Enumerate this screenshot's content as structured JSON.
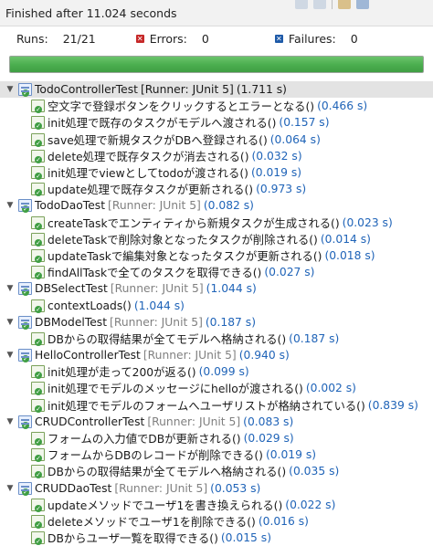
{
  "status": {
    "text": "Finished after 11.024 seconds"
  },
  "counters": {
    "runs_label": "Runs:",
    "runs_value": "21/21",
    "errors_label": "Errors:",
    "errors_value": "0",
    "failures_label": "Failures:",
    "failures_value": "0"
  },
  "progress": {
    "fraction": 1.0,
    "color": "#4caf50"
  },
  "suites": [
    {
      "name": "TodoControllerTest",
      "runner": "[Runner: JUnit 5]",
      "time": "(1.711 s)",
      "tests": [
        {
          "name": "空文字で登録ボタンをクリックするとエラーとなる()",
          "time": "(0.466 s)"
        },
        {
          "name": "init処理で既存のタスクがモデルへ渡される()",
          "time": "(0.157 s)"
        },
        {
          "name": "save処理で新規タスクがDBへ登録される()",
          "time": "(0.064 s)"
        },
        {
          "name": "delete処理で既存タスクが消去される()",
          "time": "(0.032 s)"
        },
        {
          "name": "init処理でviewとしてtodoが渡される()",
          "time": "(0.019 s)"
        },
        {
          "name": "update処理で既存タスクが更新される()",
          "time": "(0.973 s)"
        }
      ]
    },
    {
      "name": "TodoDaoTest",
      "runner": "[Runner: JUnit 5]",
      "time": "(0.082 s)",
      "tests": [
        {
          "name": "createTaskでエンティティから新規タスクが生成される()",
          "time": "(0.023 s)"
        },
        {
          "name": "deleteTaskで削除対象となったタスクが削除される()",
          "time": "(0.014 s)"
        },
        {
          "name": "updateTaskで編集対象となったタスクが更新される()",
          "time": "(0.018 s)"
        },
        {
          "name": "findAllTaskで全てのタスクを取得できる()",
          "time": "(0.027 s)"
        }
      ]
    },
    {
      "name": "DBSelectTest",
      "runner": "[Runner: JUnit 5]",
      "time": "(1.044 s)",
      "tests": [
        {
          "name": "contextLoads()",
          "time": "(1.044 s)"
        }
      ]
    },
    {
      "name": "DBModelTest",
      "runner": "[Runner: JUnit 5]",
      "time": "(0.187 s)",
      "tests": [
        {
          "name": "DBからの取得結果が全てモデルへ格納される()",
          "time": "(0.187 s)"
        }
      ]
    },
    {
      "name": "HelloControllerTest",
      "runner": "[Runner: JUnit 5]",
      "time": "(0.940 s)",
      "tests": [
        {
          "name": "init処理が走って200が返る()",
          "time": "(0.099 s)"
        },
        {
          "name": "init処理でモデルのメッセージにhelloが渡される()",
          "time": "(0.002 s)"
        },
        {
          "name": "init処理でモデルのフォームへユーザリストが格納されている()",
          "time": "(0.839 s)"
        }
      ]
    },
    {
      "name": "CRUDControllerTest",
      "runner": "[Runner: JUnit 5]",
      "time": "(0.083 s)",
      "tests": [
        {
          "name": "フォームの入力値でDBが更新される()",
          "time": "(0.029 s)"
        },
        {
          "name": "フォームからDBのレコードが削除できる()",
          "time": "(0.019 s)"
        },
        {
          "name": "DBからの取得結果が全てモデルへ格納される()",
          "time": "(0.035 s)"
        }
      ]
    },
    {
      "name": "CRUDDaoTest",
      "runner": "[Runner: JUnit 5]",
      "time": "(0.053 s)",
      "tests": [
        {
          "name": "updateメソッドでユーザ1を書き換えられる()",
          "time": "(0.022 s)"
        },
        {
          "name": "deleteメソッドでユーザ1を削除できる()",
          "time": "(0.016 s)"
        },
        {
          "name": "DBからユーザ一覧を取得できる()",
          "time": "(0.015 s)"
        }
      ]
    }
  ]
}
